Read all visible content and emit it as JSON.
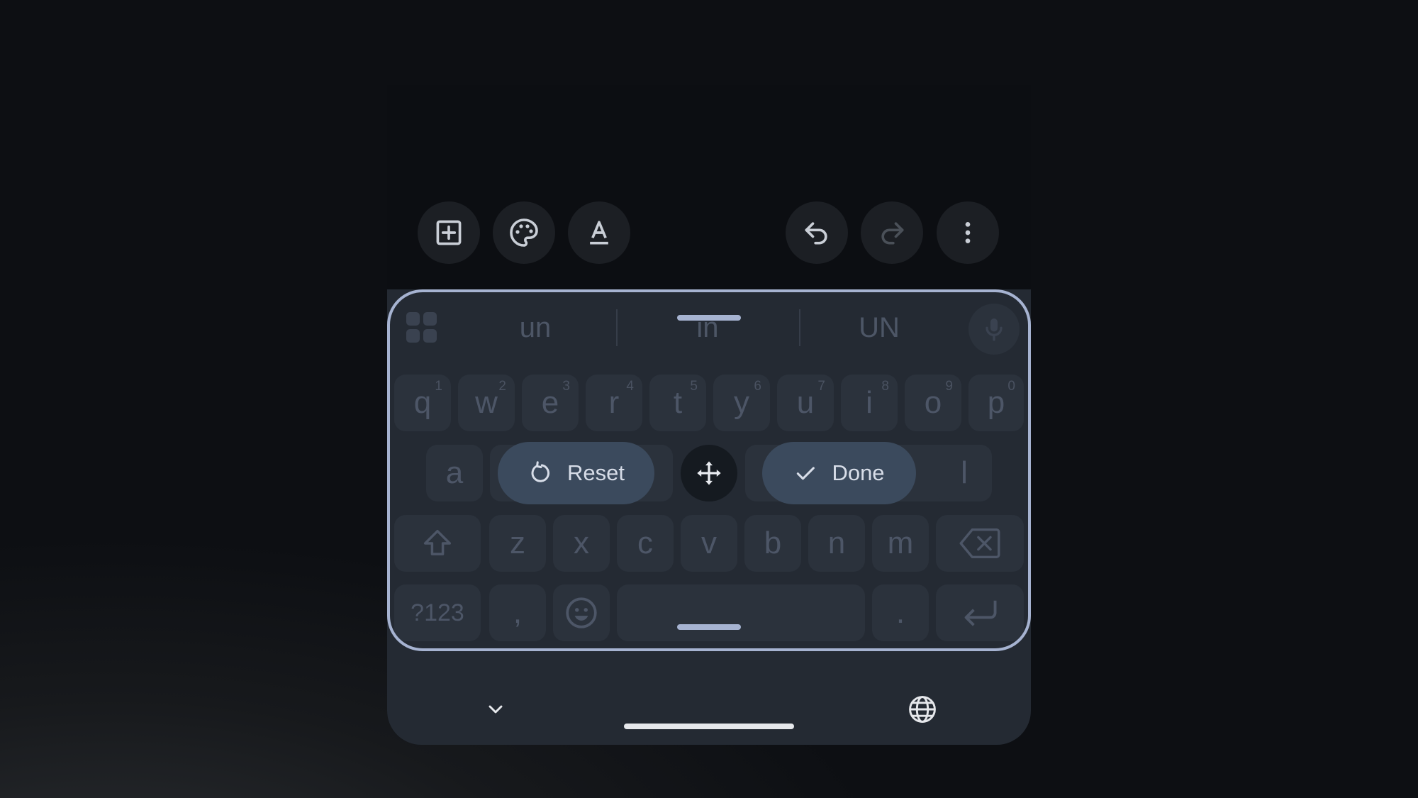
{
  "toolbar": {
    "left_icons": [
      "add-box-icon",
      "palette-icon",
      "text-format-icon"
    ],
    "right_icons": [
      "undo-icon",
      "redo-icon",
      "more-vert-icon"
    ]
  },
  "suggestions": [
    "un",
    "in",
    "UN"
  ],
  "keyboard": {
    "row1": [
      {
        "key": "q",
        "hint": "1"
      },
      {
        "key": "w",
        "hint": "2"
      },
      {
        "key": "e",
        "hint": "3"
      },
      {
        "key": "r",
        "hint": "4"
      },
      {
        "key": "t",
        "hint": "5"
      },
      {
        "key": "y",
        "hint": "6"
      },
      {
        "key": "u",
        "hint": "7"
      },
      {
        "key": "i",
        "hint": "8"
      },
      {
        "key": "o",
        "hint": "9"
      },
      {
        "key": "p",
        "hint": "0"
      }
    ],
    "row2_visible": [
      "a",
      "l"
    ],
    "row3": [
      "z",
      "x",
      "c",
      "v",
      "b",
      "n",
      "m"
    ],
    "row4": {
      "symbols_label": "?123",
      "comma": ",",
      "period": "."
    }
  },
  "edit_controls": {
    "reset_label": "Reset",
    "done_label": "Done"
  },
  "colors": {
    "accent_outline": "#a6b3d1",
    "keyboard_bg": "#242a33",
    "pill_bg": "#3b4a5d"
  }
}
